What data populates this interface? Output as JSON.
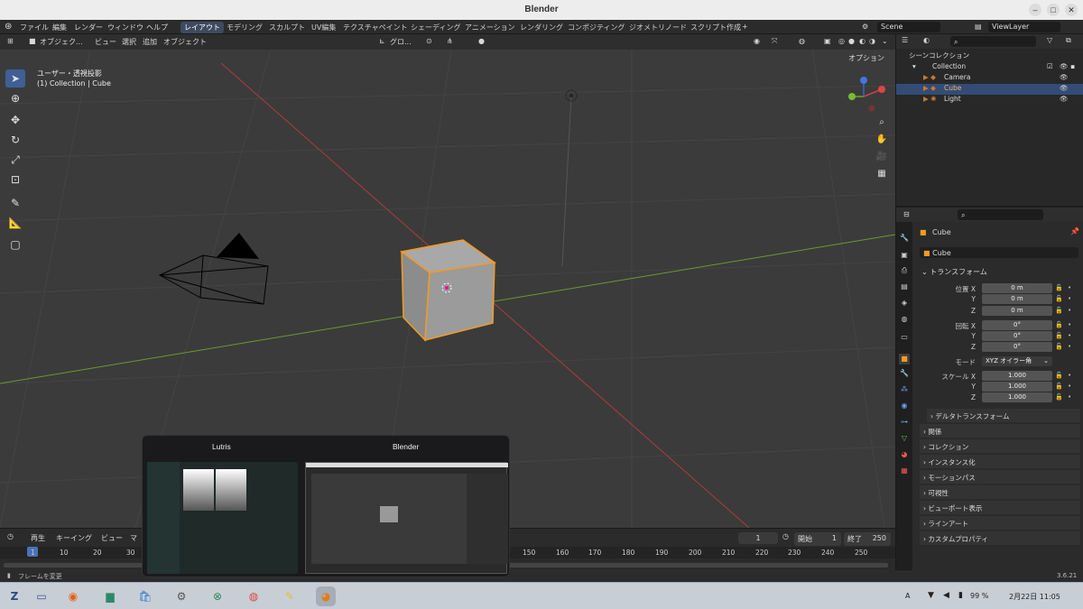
{
  "window": {
    "title": "Blender"
  },
  "menu": [
    "ファイル",
    "編集",
    "レンダー",
    "ウィンドウ",
    "ヘルプ"
  ],
  "workspaces": [
    "レイアウト",
    "モデリング",
    "スカルプト",
    "UV編集",
    "テクスチャペイント",
    "シェーディング",
    "アニメーション",
    "レンダリング",
    "コンポジティング",
    "ジオメトリノード",
    "スクリプト作成"
  ],
  "scene": {
    "scene_name": "Scene",
    "view_layer": "ViewLayer"
  },
  "viewport_header": {
    "mode": "オブジェク...",
    "items": [
      "ビュー",
      "選択",
      "追加",
      "オブジェクト"
    ],
    "transform": "グロ...",
    "options": "オプション"
  },
  "viewport": {
    "view_name": "ユーザー・透視投影",
    "context": "(1) Collection | Cube"
  },
  "outliner": {
    "root": "シーンコレクション",
    "collection": "Collection",
    "items": [
      "Camera",
      "Cube",
      "Light"
    ]
  },
  "properties": {
    "object_name": "Cube",
    "datablock": "Cube",
    "transform_header": "トランスフォーム",
    "location_label": "位置 X",
    "rotation_label": "回転 X",
    "scale_label": "スケール X",
    "axis_y": "Y",
    "axis_z": "Z",
    "loc": [
      "0 m",
      "0 m",
      "0 m"
    ],
    "rot": [
      "0°",
      "0°",
      "0°"
    ],
    "mode_label": "モード",
    "mode_value": "XYZ オイラー角",
    "scale": [
      "1.000",
      "1.000",
      "1.000"
    ],
    "delta": "デルタトランスフォーム",
    "sections": [
      "関係",
      "コレクション",
      "インスタンス化",
      "モーションパス",
      "可視性",
      "ビューポート表示",
      "ラインアート",
      "カスタムプロパティ"
    ]
  },
  "timeline": {
    "menus": [
      "再生",
      "キーイング",
      "ビュー",
      "マ"
    ],
    "current": "1",
    "start_label": "開始",
    "start": "1",
    "end_label": "終了",
    "end": "250",
    "ticks": [
      "1",
      "10",
      "20",
      "30",
      "150",
      "160",
      "170",
      "180",
      "190",
      "200",
      "210",
      "220",
      "230",
      "240",
      "250"
    ]
  },
  "status": {
    "left": "フレームを変更",
    "version": "3.6.21"
  },
  "switcher": {
    "apps": [
      "Lutris",
      "Blender"
    ]
  },
  "tray": {
    "lang": "A",
    "battery": "99 %",
    "datetime": "2月22日 11:05"
  }
}
